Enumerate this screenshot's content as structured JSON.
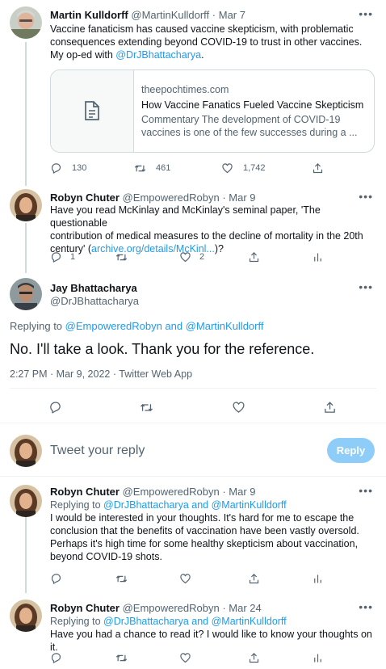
{
  "colors": {
    "accent": "#1d9bf0",
    "muted": "#536471",
    "divider": "#eff3f4"
  },
  "tweet1": {
    "name": "Martin Kulldorff",
    "handle": "@MartinKulldorff",
    "date": "· Mar 7",
    "text1": "Vaccine fanaticism has caused vaccine skepticism, with problematic",
    "text2": "consequences extending beyond COVID-19 to trust in other vaccines.",
    "text3_prefix": "My op-ed with ",
    "mention": "@DrJBhattacharya",
    "text3_suffix": ".",
    "card": {
      "domain": "theepochtimes.com",
      "title": "How Vaccine Fanatics Fueled Vaccine Skepticism",
      "desc1": "Commentary The development of COVID-19",
      "desc2": "vaccines is one of the few successes during a ..."
    },
    "replies": "130",
    "retweets": "461",
    "likes": "1,742"
  },
  "tweet2": {
    "name": "Robyn Chuter",
    "handle": "@EmpoweredRobyn",
    "date": "· Mar 9",
    "text1": "Have you read McKinlay and McKinlay's seminal paper, 'The questionable",
    "text2": "contribution of medical measures to the decline of mortality in the 20th",
    "text3_prefix": "century' (",
    "link": "archive.org/details/McKinl...",
    "text3_suffix": ")?",
    "replies": "1",
    "likes": "2"
  },
  "main": {
    "name": "Jay Bhattacharya",
    "handle": "@DrJBhattacharya",
    "replying_prefix": "Replying to ",
    "replying_to": "@EmpoweredRobyn and @MartinKulldorff",
    "text": "No. I'll take a look.  Thank you for the reference.",
    "meta": "2:27 PM · Mar 9, 2022 · Twitter Web App"
  },
  "compose": {
    "placeholder": "Tweet your reply",
    "button": "Reply"
  },
  "tweet3": {
    "name": "Robyn Chuter",
    "handle": "@EmpoweredRobyn",
    "date": "· Mar 9",
    "replying_prefix": "Replying to ",
    "replying_to": "@DrJBhattacharya and @MartinKulldorff",
    "text1": "I would be interested in your thoughts. It's hard for me to escape the",
    "text2": "conclusion that the benefits of vaccination have been vastly oversold.",
    "text3": "Perhaps it's high time for some healthy skepticism about vaccination,",
    "text4": "beyond COVID-19 shots."
  },
  "tweet4": {
    "name": "Robyn Chuter",
    "handle": "@EmpoweredRobyn",
    "date": "· Mar 24",
    "replying_prefix": "Replying to ",
    "replying_to": "@DrJBhattacharya and @MartinKulldorff",
    "text1": "Have you had a chance to read it? I would like to know your thoughts on it."
  }
}
